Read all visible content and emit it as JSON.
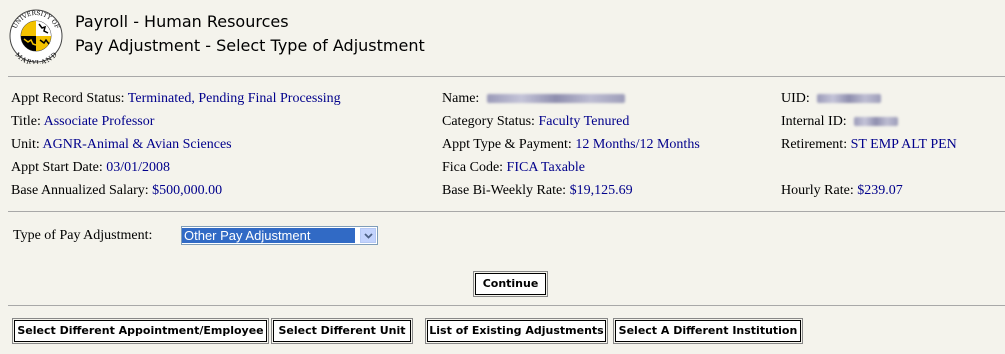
{
  "header": {
    "title": "Payroll - Human Resources",
    "subtitle": "Pay Adjustment - Select Type of Adjustment",
    "logo_text_top": "UNIVERSITY OF",
    "logo_text_bottom": "MARYLAND"
  },
  "record": {
    "appt_status_label": "Appt Record Status:",
    "appt_status_value": "Terminated, Pending Final Processing",
    "title_label": "Title:",
    "title_value": "Associate Professor",
    "unit_label": "Unit:",
    "unit_value": "AGNR-Animal & Avian Sciences",
    "start_label": "Appt Start Date:",
    "start_value": "03/01/2008",
    "salary_label": "Base Annualized Salary:",
    "salary_value": "$500,000.00",
    "name_label": "Name:",
    "category_label": "Category Status:",
    "category_value": "Faculty Tenured",
    "appt_type_label": "Appt Type & Payment:",
    "appt_type_value": "12 Months/12 Months",
    "fica_label": "Fica Code:",
    "fica_value": "FICA Taxable",
    "biweekly_label": "Base Bi-Weekly Rate:",
    "biweekly_value": "$19,125.69",
    "uid_label": "UID:",
    "internal_id_label": "Internal ID:",
    "retirement_label": "Retirement:",
    "retirement_value": "ST EMP ALT PEN",
    "hourly_label": "Hourly Rate:",
    "hourly_value": "$239.07"
  },
  "adjustment": {
    "label": "Type of Pay Adjustment:",
    "selected": "Other Pay Adjustment"
  },
  "actions": {
    "continue": "Continue",
    "select_employee": "Select Different Appointment/Employee",
    "select_unit": "Select Different Unit",
    "list_existing": "List of Existing Adjustments",
    "select_institution": "Select A Different Institution"
  },
  "colors": {
    "background": "#f4f3ec",
    "value_text": "#00008b",
    "select_highlight": "#316ac5"
  }
}
